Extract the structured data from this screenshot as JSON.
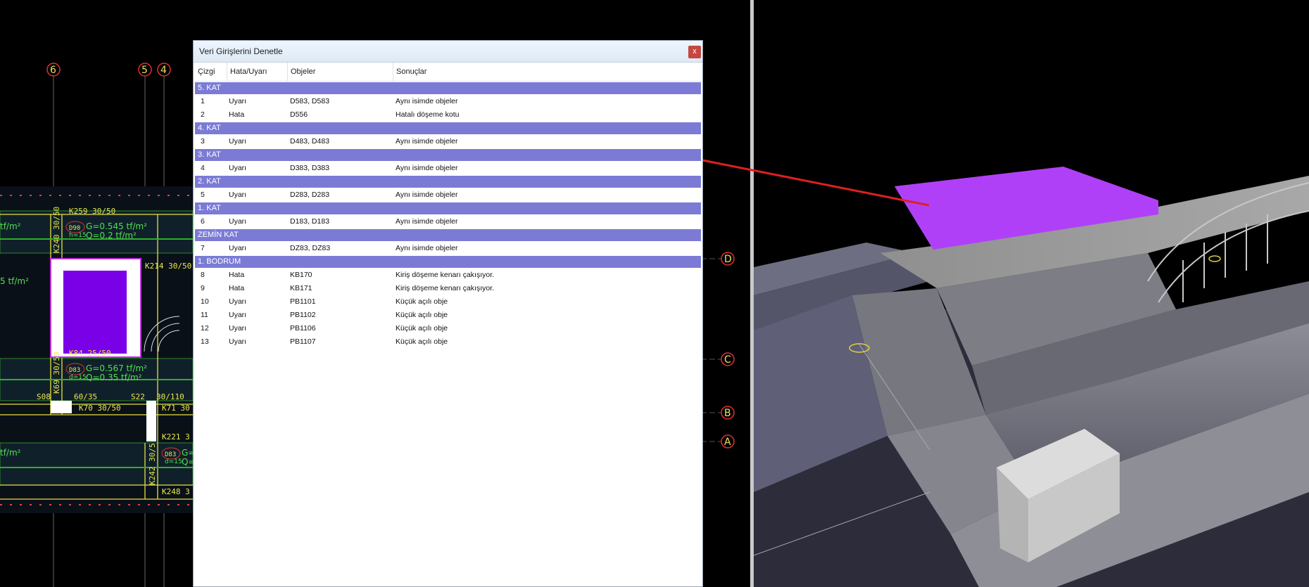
{
  "dialog": {
    "title": "Veri Girişlerini Denetle",
    "close_label": "x",
    "columns": [
      "Çizgi",
      "Hata/Uyarı",
      "Objeler",
      "Sonuçlar"
    ]
  },
  "groups": [
    {
      "label": "5. KAT",
      "rows": [
        {
          "no": "1",
          "type": "Uyarı",
          "objects": "D583, D583",
          "result": "Aynı isimde objeler"
        },
        {
          "no": "2",
          "type": "Hata",
          "objects": "D556",
          "result": "Hatalı döşeme kotu"
        }
      ]
    },
    {
      "label": "4. KAT",
      "rows": [
        {
          "no": "3",
          "type": "Uyarı",
          "objects": "D483, D483",
          "result": "Aynı isimde objeler"
        }
      ]
    },
    {
      "label": "3. KAT",
      "rows": [
        {
          "no": "4",
          "type": "Uyarı",
          "objects": "D383, D383",
          "result": "Aynı isimde objeler"
        }
      ]
    },
    {
      "label": "2. KAT",
      "rows": [
        {
          "no": "5",
          "type": "Uyarı",
          "objects": "D283, D283",
          "result": "Aynı isimde objeler"
        }
      ]
    },
    {
      "label": "1. KAT",
      "rows": [
        {
          "no": "6",
          "type": "Uyarı",
          "objects": "D183, D183",
          "result": "Aynı isimde objeler"
        }
      ]
    },
    {
      "label": "ZEMİN KAT",
      "rows": [
        {
          "no": "7",
          "type": "Uyarı",
          "objects": "DZ83, DZ83",
          "result": "Aynı isimde objeler"
        }
      ]
    },
    {
      "label": "1. BODRUM",
      "rows": [
        {
          "no": "8",
          "type": "Hata",
          "objects": "KB170",
          "result": "Kiriş döşeme kenarı çakışıyor."
        },
        {
          "no": "9",
          "type": "Hata",
          "objects": "KB171",
          "result": "Kiriş döşeme kenarı çakışıyor."
        },
        {
          "no": "10",
          "type": "Uyarı",
          "objects": "PB1101",
          "result": "Küçük açılı obje"
        },
        {
          "no": "11",
          "type": "Uyarı",
          "objects": "PB1102",
          "result": "Küçük açılı obje"
        },
        {
          "no": "12",
          "type": "Uyarı",
          "objects": "PB1106",
          "result": "Küçük açılı obje"
        },
        {
          "no": "13",
          "type": "Uyarı",
          "objects": "PB1107",
          "result": "Küçük açılı obje"
        }
      ]
    }
  ],
  "cad": {
    "axes_top": [
      "6",
      "5",
      "4"
    ],
    "axes_right": [
      "D",
      "C",
      "B",
      "A"
    ],
    "beams": [
      "K259  30/50",
      "K240 30/50",
      "K214  30/50",
      "K84 25/50",
      "K69 30/50",
      "K70  30/50",
      "K71  30",
      "K221  3",
      "K242 30/5",
      "K248  3",
      "60/35",
      "30/110",
      "S08",
      "S22"
    ],
    "slabs": [
      "D90",
      "D83",
      "D83"
    ],
    "loads": [
      "G=0.545 tf/m²",
      "Q=0.2 tf/m²",
      "G=0.567 tf/m²",
      "Q=0.35 tf/m²",
      "tf/m²",
      "5 tf/m²",
      "tf/m²",
      "G=",
      "Q=",
      "h=15",
      "d=15",
      "d=15"
    ]
  },
  "colors": {
    "group_header": "#7b7bd6",
    "highlight_slab": "#b040f8",
    "pointer_line": "#e02020"
  }
}
